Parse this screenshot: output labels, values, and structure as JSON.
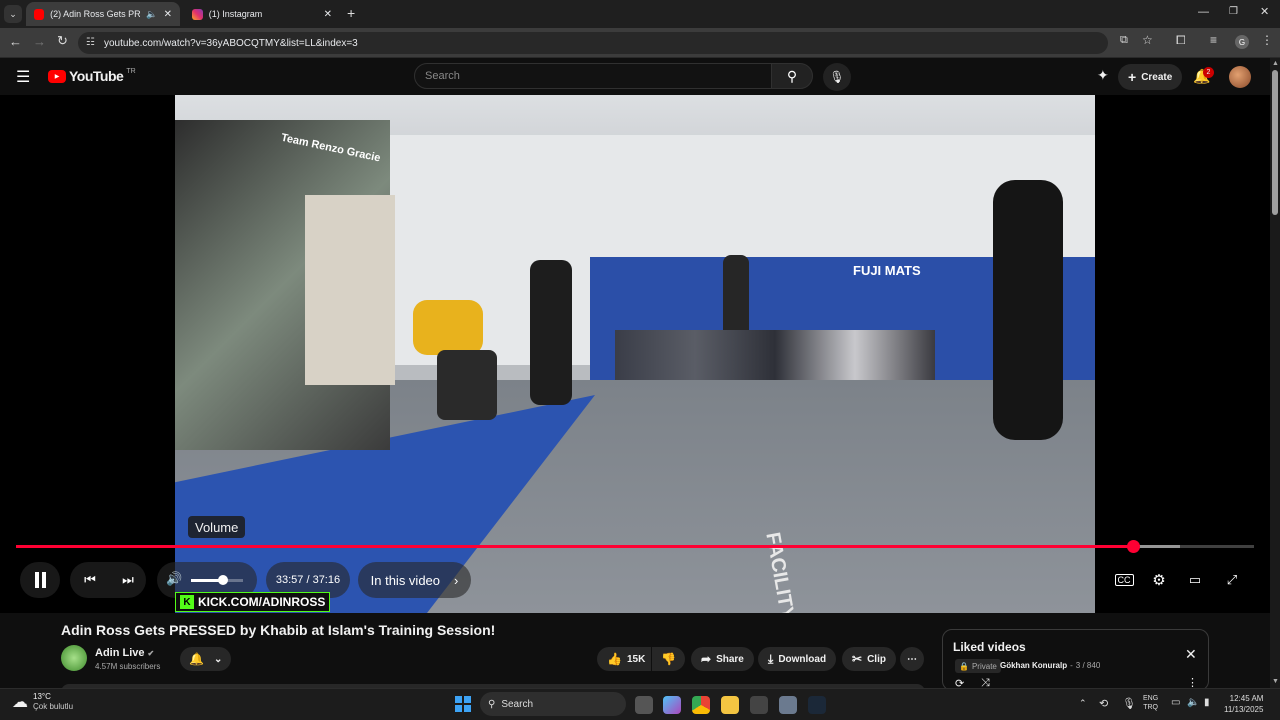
{
  "tabs": [
    {
      "title": "(2) Adin Ross Gets PRESSED",
      "favicon": "youtube-icon",
      "color": "#ff0000",
      "active": true
    },
    {
      "title": "(1) Instagram",
      "favicon": "instagram-icon",
      "color": "#e1306c",
      "active": false
    }
  ],
  "address": {
    "url": "youtube.com/watch?v=36yABOCQTMY&list=LL&index=3"
  },
  "youtube": {
    "logo_text": "YouTube",
    "region": "TR",
    "search_placeholder": "Search",
    "create_label": "Create",
    "notification_count": "2"
  },
  "player": {
    "tooltip": "Volume",
    "time": "33:57 / 37:16",
    "chapter_label": "In this video",
    "progress": 0.902,
    "buffered": 0.94,
    "volume": 0.62,
    "watermark": "KICK.COM/ADINROSS",
    "scene": {
      "banner": "Team Renzo Gracie",
      "mats": "FUJI MATS",
      "floor_text": "FACILITY"
    }
  },
  "video": {
    "title": "Adin Ross Gets PRESSED by Khabib at Islam's Training Session!",
    "channel": "Adin Live",
    "subscribers": "4.57M subscribers",
    "likes": "15K",
    "share_label": "Share",
    "download_label": "Download",
    "clip_label": "Clip"
  },
  "playlist": {
    "title": "Liked videos",
    "privacy": "Private",
    "owner": "Gökhan Konuralp",
    "position": "3 / 840"
  },
  "taskbar": {
    "weather_temp": "13°C",
    "weather_desc": "Çok bulutlu",
    "search_label": "Search",
    "lang_top": "ENG",
    "lang_bottom": "TRQ",
    "time": "12:45 AM",
    "date": "11/13/2025"
  },
  "colors": {
    "accent": "#ff0033",
    "youtube_red": "#ff0000",
    "bg": "#0f0f0f"
  }
}
